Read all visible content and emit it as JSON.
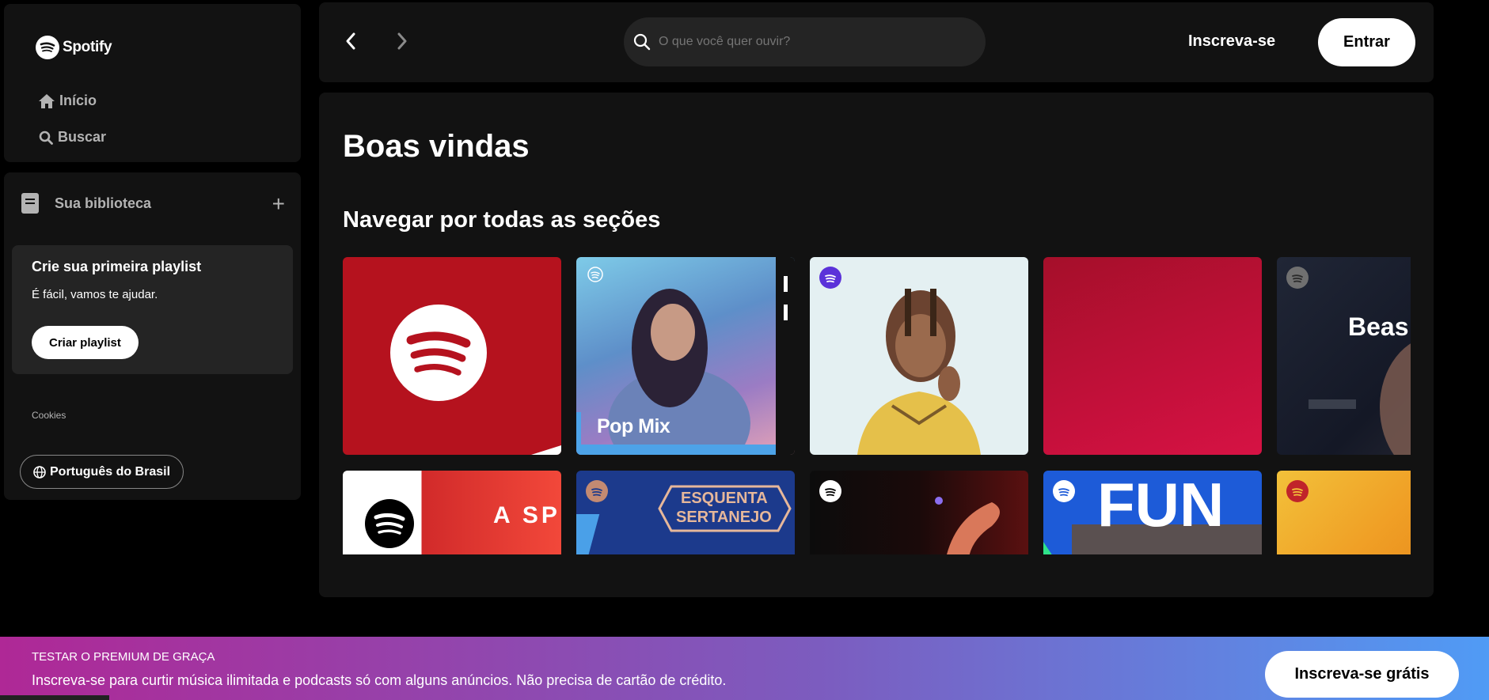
{
  "brand": {
    "name": "Spotify"
  },
  "nav": {
    "home": "Início",
    "search": "Buscar"
  },
  "library": {
    "title": "Sua biblioteca",
    "add_label": "+",
    "card_title": "Crie sua primeira playlist",
    "card_subtitle": "É fácil, vamos te ajudar.",
    "card_button": "Criar playlist",
    "cookies": "Cookies",
    "language": "Português do Brasil"
  },
  "topbar": {
    "search_placeholder": "O que você quer ouvir?",
    "signup": "Inscreva-se",
    "login": "Entrar"
  },
  "main": {
    "welcome": "Boas vindas",
    "section_title": "Navegar por todas as seções",
    "card_texts": {
      "pop_mix": "Pop Mix",
      "beast": "Beas",
      "esquenta_1": "ESQUENTA",
      "esquenta_2": "SERTANEJO",
      "funk": "FUN",
      "asp": "A SP"
    }
  },
  "banner": {
    "title": "TESTAR O PREMIUM DE GRAÇA",
    "text": "Inscreva-se para curtir música ilimitada e podcasts só com alguns anúncios. Não precisa de cartão de crédito.",
    "button": "Inscreva-se grátis"
  },
  "colors": {
    "accent_red": "#b8101f",
    "background": "#121212",
    "surface": "#242424"
  },
  "icons": [
    "spotify-logo-icon",
    "home-icon",
    "search-icon",
    "library-icon",
    "plus-icon",
    "globe-icon",
    "chevron-left-icon",
    "chevron-right-icon"
  ]
}
